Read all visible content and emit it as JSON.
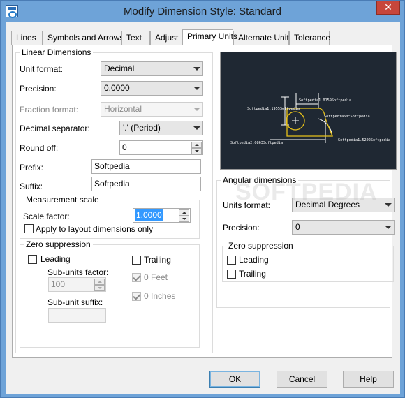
{
  "window": {
    "title": "Modify Dimension Style: Standard",
    "close_glyph": "✕"
  },
  "tabs": [
    {
      "label": "Lines"
    },
    {
      "label": "Symbols and Arrows"
    },
    {
      "label": "Text"
    },
    {
      "label": "Adjust"
    },
    {
      "label": "Primary Units"
    },
    {
      "label": "Alternate Units"
    },
    {
      "label": "Tolerance"
    }
  ],
  "active_tab": "Primary Units",
  "linear": {
    "group_label": "Linear Dimensions",
    "unit_format_label": "Unit format:",
    "unit_format_value": "Decimal",
    "precision_label": "Precision:",
    "precision_value": "0.0000",
    "fraction_format_label": "Fraction format:",
    "fraction_format_value": "Horizontal",
    "decimal_separator_label": "Decimal separator:",
    "decimal_separator_value": "'.' (Period)",
    "round_off_label": "Round off:",
    "round_off_value": "0",
    "prefix_label": "Prefix:",
    "prefix_value": "Softpedia",
    "suffix_label": "Suffix:",
    "suffix_value": "Softpedia"
  },
  "measurement": {
    "group_label": "Measurement scale",
    "scale_factor_label": "Scale factor:",
    "scale_factor_value": "1.0000",
    "apply_layout_label": "Apply to layout dimensions only"
  },
  "zero_linear": {
    "group_label": "Zero suppression",
    "leading_label": "Leading",
    "trailing_label": "Trailing",
    "sub_units_factor_label": "Sub-units factor:",
    "sub_units_factor_value": "100",
    "zero_feet_label": "0 Feet",
    "zero_inches_label": "0 Inches",
    "sub_unit_suffix_label": "Sub-unit suffix:",
    "sub_unit_suffix_value": ""
  },
  "angular": {
    "group_label": "Angular dimensions",
    "units_format_label": "Units format:",
    "units_format_value": "Decimal Degrees",
    "precision_label": "Precision:",
    "precision_value": "0",
    "zero_group_label": "Zero suppression",
    "leading_label": "Leading",
    "trailing_label": "Trailing"
  },
  "preview": {
    "dim_top": "Softpedia1.0159Softpedia",
    "dim_left": "Softpedia1.1955Softpedia",
    "dim_bottom": "Softpedia2.0863Softpedia",
    "dim_angle": "Softpedia60°Softpedia",
    "dim_right": "Softpedia1.5202Softpedia"
  },
  "watermark": "SOFTPEDIA",
  "buttons": {
    "ok": "OK",
    "cancel": "Cancel",
    "help": "Help"
  }
}
